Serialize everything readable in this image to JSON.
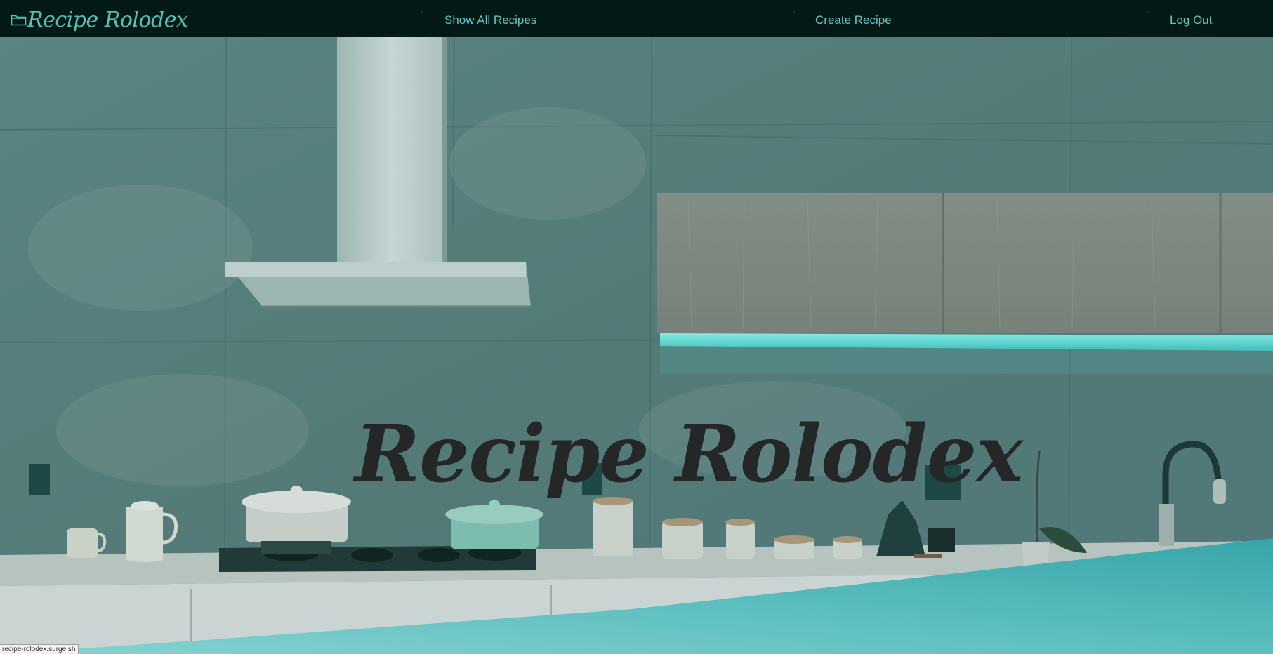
{
  "nav": {
    "brand": "Recipe Rolodex",
    "brand_icon": "folder-icon",
    "links": [
      {
        "label": "Show All Recipes"
      },
      {
        "label": "Create Recipe"
      },
      {
        "label": "Log Out"
      }
    ]
  },
  "hero": {
    "title": "Recipe Rolodex"
  },
  "status_bar": {
    "url": "recipe-rolodex.surge.sh"
  },
  "colors": {
    "nav_bg": "#031915",
    "accent": "#60c8c2",
    "hero_title": "#242628",
    "wave": "#4fbdba"
  }
}
